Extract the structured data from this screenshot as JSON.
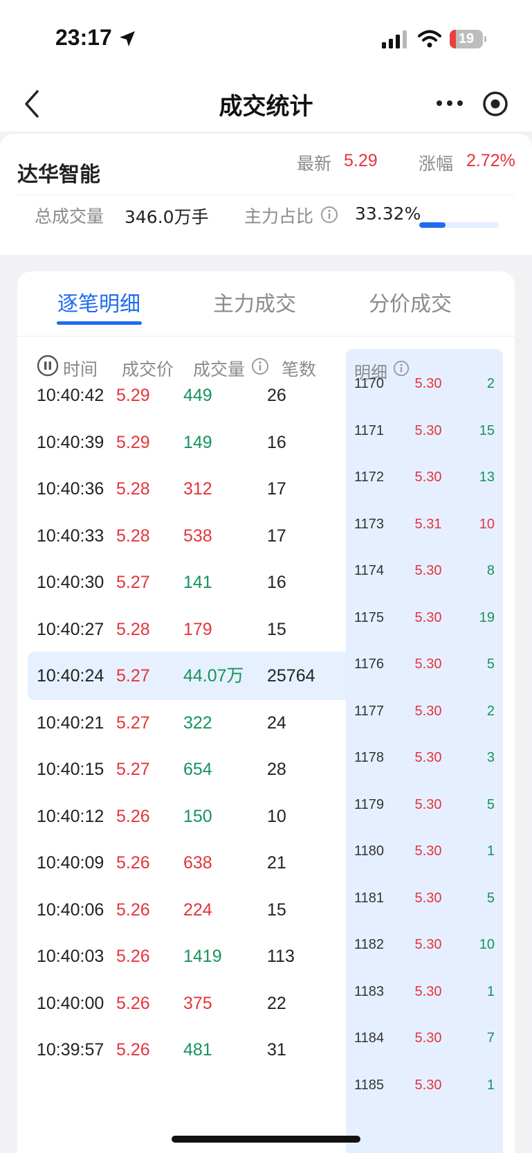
{
  "status_bar": {
    "time": "23:17",
    "battery": "19",
    "battery_percent": 19
  },
  "nav": {
    "title": "成交统计"
  },
  "summary": {
    "stock_name": "达华智能",
    "latest_label": "最新",
    "latest_value": "5.29",
    "change_label": "涨幅",
    "change_value": "2.72%",
    "total_volume_label": "总成交量",
    "total_volume_value": "346.0万手",
    "main_ratio_label": "主力占比",
    "main_ratio_value": "33.32%",
    "main_ratio_percent": 33.32
  },
  "tabs": [
    {
      "label": "逐笔明细",
      "active": true
    },
    {
      "label": "主力成交",
      "active": false
    },
    {
      "label": "分价成交",
      "active": false
    }
  ],
  "columns": {
    "time": "时间",
    "price": "成交价",
    "volume": "成交量",
    "count": "笔数"
  },
  "trades": [
    {
      "time": "10:40:42",
      "price": "5.29",
      "volume": "449",
      "count": "26",
      "price_color": "red",
      "volume_color": "green",
      "highlight": false
    },
    {
      "time": "10:40:39",
      "price": "5.29",
      "volume": "149",
      "count": "16",
      "price_color": "red",
      "volume_color": "green",
      "highlight": false
    },
    {
      "time": "10:40:36",
      "price": "5.28",
      "volume": "312",
      "count": "17",
      "price_color": "red",
      "volume_color": "red",
      "highlight": false
    },
    {
      "time": "10:40:33",
      "price": "5.28",
      "volume": "538",
      "count": "17",
      "price_color": "red",
      "volume_color": "red",
      "highlight": false
    },
    {
      "time": "10:40:30",
      "price": "5.27",
      "volume": "141",
      "count": "16",
      "price_color": "red",
      "volume_color": "green",
      "highlight": false
    },
    {
      "time": "10:40:27",
      "price": "5.28",
      "volume": "179",
      "count": "15",
      "price_color": "red",
      "volume_color": "red",
      "highlight": false
    },
    {
      "time": "10:40:24",
      "price": "5.27",
      "volume": "44.07万",
      "count": "25764",
      "price_color": "red",
      "volume_color": "green",
      "highlight": true
    },
    {
      "time": "10:40:21",
      "price": "5.27",
      "volume": "322",
      "count": "24",
      "price_color": "red",
      "volume_color": "green",
      "highlight": false
    },
    {
      "time": "10:40:15",
      "price": "5.27",
      "volume": "654",
      "count": "28",
      "price_color": "red",
      "volume_color": "green",
      "highlight": false
    },
    {
      "time": "10:40:12",
      "price": "5.26",
      "volume": "150",
      "count": "10",
      "price_color": "red",
      "volume_color": "green",
      "highlight": false
    },
    {
      "time": "10:40:09",
      "price": "5.26",
      "volume": "638",
      "count": "21",
      "price_color": "red",
      "volume_color": "red",
      "highlight": false
    },
    {
      "time": "10:40:06",
      "price": "5.26",
      "volume": "224",
      "count": "15",
      "price_color": "red",
      "volume_color": "red",
      "highlight": false
    },
    {
      "time": "10:40:03",
      "price": "5.26",
      "volume": "1419",
      "count": "113",
      "price_color": "red",
      "volume_color": "green",
      "highlight": false
    },
    {
      "time": "10:40:00",
      "price": "5.26",
      "volume": "375",
      "count": "22",
      "price_color": "red",
      "volume_color": "red",
      "highlight": false
    },
    {
      "time": "10:39:57",
      "price": "5.26",
      "volume": "481",
      "count": "31",
      "price_color": "red",
      "volume_color": "green",
      "highlight": false
    }
  ],
  "detail_panel": {
    "title": "明细",
    "rows": [
      {
        "num": "1170",
        "price": "5.30",
        "count": "2",
        "count_color": "green"
      },
      {
        "num": "1171",
        "price": "5.30",
        "count": "15",
        "count_color": "green"
      },
      {
        "num": "1172",
        "price": "5.30",
        "count": "13",
        "count_color": "green"
      },
      {
        "num": "1173",
        "price": "5.31",
        "count": "10",
        "count_color": "red"
      },
      {
        "num": "1174",
        "price": "5.30",
        "count": "8",
        "count_color": "green"
      },
      {
        "num": "1175",
        "price": "5.30",
        "count": "19",
        "count_color": "green"
      },
      {
        "num": "1176",
        "price": "5.30",
        "count": "5",
        "count_color": "green"
      },
      {
        "num": "1177",
        "price": "5.30",
        "count": "2",
        "count_color": "green"
      },
      {
        "num": "1178",
        "price": "5.30",
        "count": "3",
        "count_color": "green"
      },
      {
        "num": "1179",
        "price": "5.30",
        "count": "5",
        "count_color": "green"
      },
      {
        "num": "1180",
        "price": "5.30",
        "count": "1",
        "count_color": "green"
      },
      {
        "num": "1181",
        "price": "5.30",
        "count": "5",
        "count_color": "green"
      },
      {
        "num": "1182",
        "price": "5.30",
        "count": "10",
        "count_color": "green"
      },
      {
        "num": "1183",
        "price": "5.30",
        "count": "1",
        "count_color": "green"
      },
      {
        "num": "1184",
        "price": "5.30",
        "count": "7",
        "count_color": "green"
      },
      {
        "num": "1185",
        "price": "5.30",
        "count": "1",
        "count_color": "green"
      }
    ]
  },
  "colors": {
    "accent": "#1e6bf0",
    "up": "#e5343c",
    "down": "#15935b"
  }
}
